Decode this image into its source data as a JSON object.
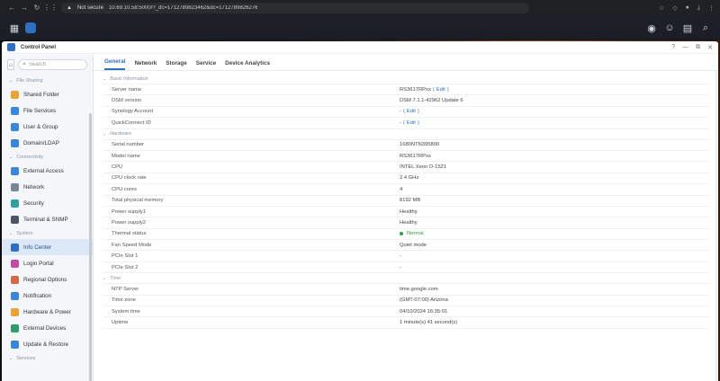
{
  "browser": {
    "not_secure": "Not secure",
    "url": "10.69.10.58:5000/?_dc=1712789823462&dc=1712789826276"
  },
  "window": {
    "title": "Control Panel",
    "controls": [
      "?",
      "—",
      "⧉",
      "✕"
    ]
  },
  "sidebar": {
    "search_placeholder": "Search",
    "groups": [
      {
        "header": "File Sharing",
        "items": [
          {
            "label": "Shared Folder",
            "color": "#e7a23a"
          },
          {
            "label": "File Services",
            "color": "#3a86d8"
          },
          {
            "label": "User & Group",
            "color": "#3a86d8"
          },
          {
            "label": "Domain/LDAP",
            "color": "#3a86d8"
          }
        ]
      },
      {
        "header": "Connectivity",
        "items": [
          {
            "label": "External Access",
            "color": "#3a86d8"
          },
          {
            "label": "Network",
            "color": "#7d8794"
          },
          {
            "label": "Security",
            "color": "#2f9e9e"
          },
          {
            "label": "Terminal & SNMP",
            "color": "#4b5563"
          }
        ]
      },
      {
        "header": "System",
        "items": [
          {
            "label": "Info Center",
            "color": "#2f6fc0",
            "active": true
          },
          {
            "label": "Login Portal",
            "color": "#c24aa8"
          },
          {
            "label": "Regional Options",
            "color": "#d9674a"
          },
          {
            "label": "Notification",
            "color": "#3a86d8"
          },
          {
            "label": "Hardware & Power",
            "color": "#e7a23a"
          },
          {
            "label": "External Devices",
            "color": "#2f9e6e"
          },
          {
            "label": "Update & Restore",
            "color": "#3a86d8"
          }
        ]
      },
      {
        "header": "Services",
        "items": []
      }
    ]
  },
  "tabs": [
    "General",
    "Network",
    "Storage",
    "Service",
    "Device Analytics"
  ],
  "active_tab": "General",
  "sections": [
    {
      "header": "Basic Information",
      "rows": [
        {
          "label": "Server name",
          "value": "RS3617RPxs",
          "edit": "Edit"
        },
        {
          "label": "DSM version",
          "value": "DSM 7.1.1-42962 Update 6"
        },
        {
          "label": "Synology Account",
          "value": "-",
          "edit": "Edit"
        },
        {
          "label": "QuickConnect ID",
          "value": "-",
          "edit": "Edit"
        }
      ]
    },
    {
      "header": "Hardware",
      "rows": [
        {
          "label": "Serial number",
          "value": "1680NTN395800"
        },
        {
          "label": "Model name",
          "value": "RS3617RPxs"
        },
        {
          "label": "CPU",
          "value": "INTEL Xeon D-1521"
        },
        {
          "label": "CPU clock rate",
          "value": "2.4 GHz"
        },
        {
          "label": "CPU cores",
          "value": "4"
        },
        {
          "label": "Total physical memory",
          "value": "8192 MB"
        },
        {
          "label": "Power supply1",
          "value": "Healthy"
        },
        {
          "label": "Power supply2",
          "value": "Healthy"
        },
        {
          "label": "Thermal status",
          "value": "Normal",
          "status": "green"
        },
        {
          "label": "Fan Speed Mode",
          "value": "Quiet mode"
        },
        {
          "label": "PCIe Slot 1",
          "value": "-"
        },
        {
          "label": "PCIe Slot 2",
          "value": "-"
        }
      ]
    },
    {
      "header": "Time",
      "rows": [
        {
          "label": "NTP Server",
          "value": "time.google.com"
        },
        {
          "label": "Time zone",
          "value": "(GMT-07:00) Arizona"
        },
        {
          "label": "System time",
          "value": "04/10/2024 16:35:01"
        },
        {
          "label": "Uptime",
          "value": "1 minute(s) 41 second(s)"
        }
      ]
    }
  ]
}
